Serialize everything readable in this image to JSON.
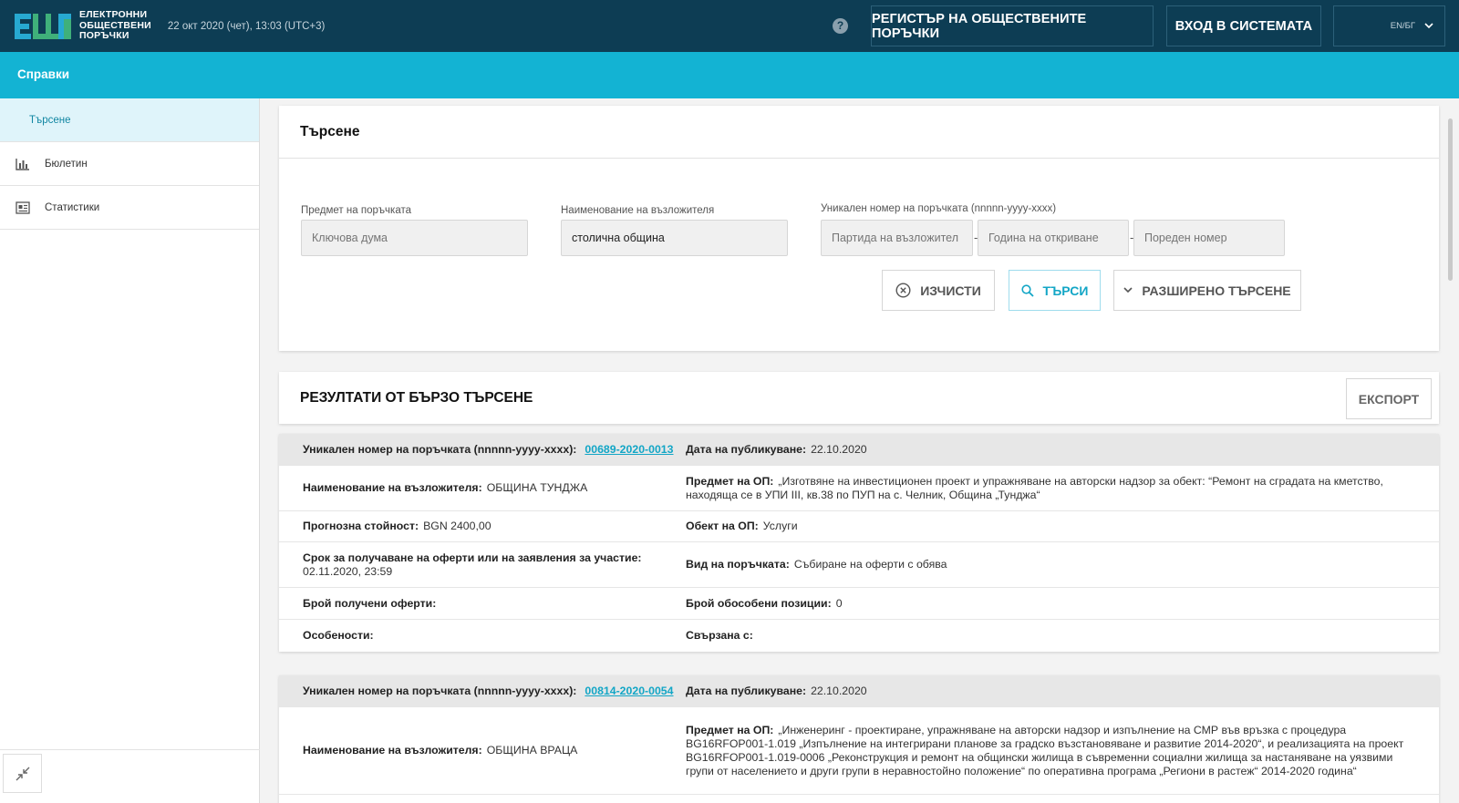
{
  "header": {
    "logo_line1": "ЕЛЕКТРОННИ",
    "logo_line2": "ОБЩЕСТВЕНИ",
    "logo_line3": "ПОРЪЧКИ",
    "datetime": "22 окт 2020 (чет), 13:03 (UTC+3)",
    "help": "?",
    "register_label": "РЕГИСТЪР НА ОБЩЕСТВЕНИТЕ ПОРЪЧКИ",
    "login_label": "ВХОД В СИСТЕМАТА",
    "lang": "EN/БГ"
  },
  "subheader": {
    "title": "Справки"
  },
  "sidebar": {
    "items": [
      {
        "label": "Търсене",
        "icon": "search-nav"
      },
      {
        "label": "Бюлетин",
        "icon": "bar-chart-icon"
      },
      {
        "label": "Статистики",
        "icon": "stats-card-icon"
      }
    ]
  },
  "search": {
    "title": "Търсене",
    "subject_label": "Предмет на поръчката",
    "subject_placeholder": "Ключова дума",
    "contractor_label": "Наименование на възложителя",
    "contractor_value": "столична община",
    "unique_label": "Уникален номер на поръчката (nnnnn-yyyy-xxxx)",
    "party_placeholder": "Партида на възложител",
    "year_placeholder": "Година на откриване",
    "seq_placeholder": "Пореден номер",
    "dash": "-",
    "clear_label": "ИЗЧИСТИ",
    "search_label": "ТЪРСИ",
    "advanced_label": "РАЗШИРЕНО ТЪРСЕНЕ"
  },
  "results": {
    "title": "РЕЗУЛТАТИ ОТ БЪРЗО ТЪРСЕНЕ",
    "export_label": "ЕКСПОРТ",
    "labels": {
      "unique": "Уникален номер на поръчката (nnnnn-yyyy-xxxx):",
      "published": "Дата на публикуване:",
      "contractor": "Наименование на възложителя:",
      "subject": "Предмет на ОП:",
      "estimate": "Прогнозна стойност:",
      "object": "Обект на ОП:",
      "deadline": "Срок за получаване на оферти или на заявления за участие:",
      "type": "Вид на поръчката:",
      "offers": "Брой получени оферти:",
      "lots": "Брой обособени позиции:",
      "features": "Особености:",
      "related": "Свързана с:"
    },
    "items": [
      {
        "unique": "00689-2020-0013",
        "published": "22.10.2020",
        "contractor": "ОБЩИНА ТУНДЖА",
        "subject": "„Изготвяне на инвестиционен проект и упражняване на авторски надзор за обект: “Ремонт на сградата на кметство, находяща се в УПИ III, кв.38 по ПУП на с. Челник, Община „Тунджа“",
        "estimate": "BGN 2400,00",
        "object": "Услуги",
        "deadline": "02.11.2020, 23:59",
        "type": "Събиране на оферти с обява",
        "offers": "",
        "lots": "0",
        "features": "",
        "related": ""
      },
      {
        "unique": "00814-2020-0054",
        "published": "22.10.2020",
        "contractor": "ОБЩИНА ВРАЦА",
        "subject": "„Инженеринг - проектиране, упражняване на авторски надзор и изпълнение на СМР във връзка с процедура BG16RFOP001-1.019 „Изпълнение на интегрирани планове за градско възстановяване и развитие 2014-2020“, и реализацията на проект BG16RFOP001-1.019-0006 „Реконструкция и ремонт на общински жилища в съвременни социални жилища за настаняване на уязвими групи от населението и други групи в неравностойно положение“ по оперативна програма „Региони в растеж“ 2014-2020 година“"
      }
    ]
  }
}
